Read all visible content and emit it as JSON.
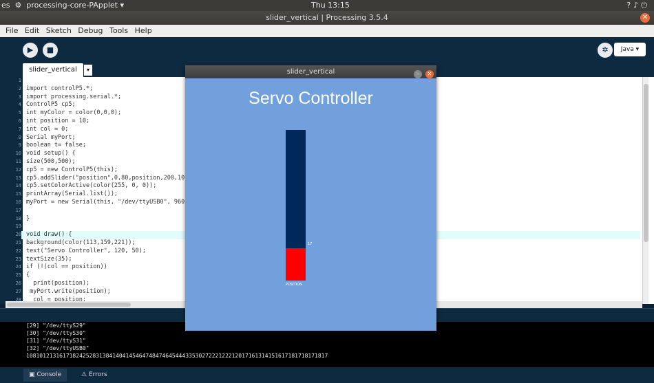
{
  "os_topbar": {
    "activities": "es",
    "app_menu": "processing-core-PApplet ▾",
    "clock": "Thu 13:15"
  },
  "window": {
    "title": "slider_vertical | Processing 3.5.4"
  },
  "menu": [
    "File",
    "Edit",
    "Sketch",
    "Debug",
    "Tools",
    "Help"
  ],
  "toolbar": {
    "mode": "Java ▾"
  },
  "tab": {
    "name": "slider_vertical"
  },
  "code_lines": [
    {
      "n": "1",
      "text": ""
    },
    {
      "n": "2",
      "text": "import controlP5.*;"
    },
    {
      "n": "3",
      "text": "import processing.serial.*;"
    },
    {
      "n": "4",
      "text": "ControlP5 cp5;"
    },
    {
      "n": "5",
      "text": "int myColor = color(0,0,0);"
    },
    {
      "n": "6",
      "text": "int position = 10;"
    },
    {
      "n": "7",
      "text": "int col = 0;"
    },
    {
      "n": "8",
      "text": "Serial myPort;"
    },
    {
      "n": "9",
      "text": "boolean t= false;"
    },
    {
      "n": "10",
      "text": "void setup() {"
    },
    {
      "n": "11",
      "text": "size(500,500);"
    },
    {
      "n": "12",
      "text": "cp5 = new ControlP5(this);"
    },
    {
      "n": "13",
      "text": "cp5.addSlider(\"position\",0,80,position,200,10"
    },
    {
      "n": "14",
      "text": "cp5.setColorActive(color(255, 0, 0));"
    },
    {
      "n": "15",
      "text": "printArray(Serial.list());"
    },
    {
      "n": "16",
      "text": "myPort = new Serial(this, \"/dev/ttyUSB0\", 960"
    },
    {
      "n": "17",
      "text": ""
    },
    {
      "n": "18",
      "text": "}"
    },
    {
      "n": "19",
      "text": ""
    },
    {
      "n": "20",
      "text": "void draw() {"
    },
    {
      "n": "21",
      "text": "background(color(113,159,221));"
    },
    {
      "n": "22",
      "text": "text(\"Servo Controller\", 120, 50);"
    },
    {
      "n": "23",
      "text": "textSize(35);"
    },
    {
      "n": "24",
      "text": "if (!(col == position))"
    },
    {
      "n": "25",
      "text": "{"
    },
    {
      "n": "26",
      "text": "  print(position);"
    },
    {
      "n": "27",
      "text": " myPort.write(position);"
    },
    {
      "n": "28",
      "text": "  col = position;"
    }
  ],
  "console_lines": [
    "[29] \"/dev/ttyS29\"",
    "[30] \"/dev/ttyS30\"",
    "[31] \"/dev/ttyS31\"",
    "[32] \"/dev/ttyUSB0\"",
    "1081012131617182425283138414041454647484746454443353027222122212017161314151617181718171817"
  ],
  "status_tabs": {
    "console": "Console",
    "errors": "Errors"
  },
  "sketch_window": {
    "title": "slider_vertical",
    "heading": "Servo Controller",
    "slider": {
      "label": "POSITION",
      "value": "17",
      "min": 0,
      "max": 80,
      "fraction": 0.2125
    }
  },
  "colors": {
    "sketch_background": "#71a0dd",
    "slider_track": "#02285a",
    "slider_active": "#ff0000",
    "ide_background": "#0e2a40"
  }
}
